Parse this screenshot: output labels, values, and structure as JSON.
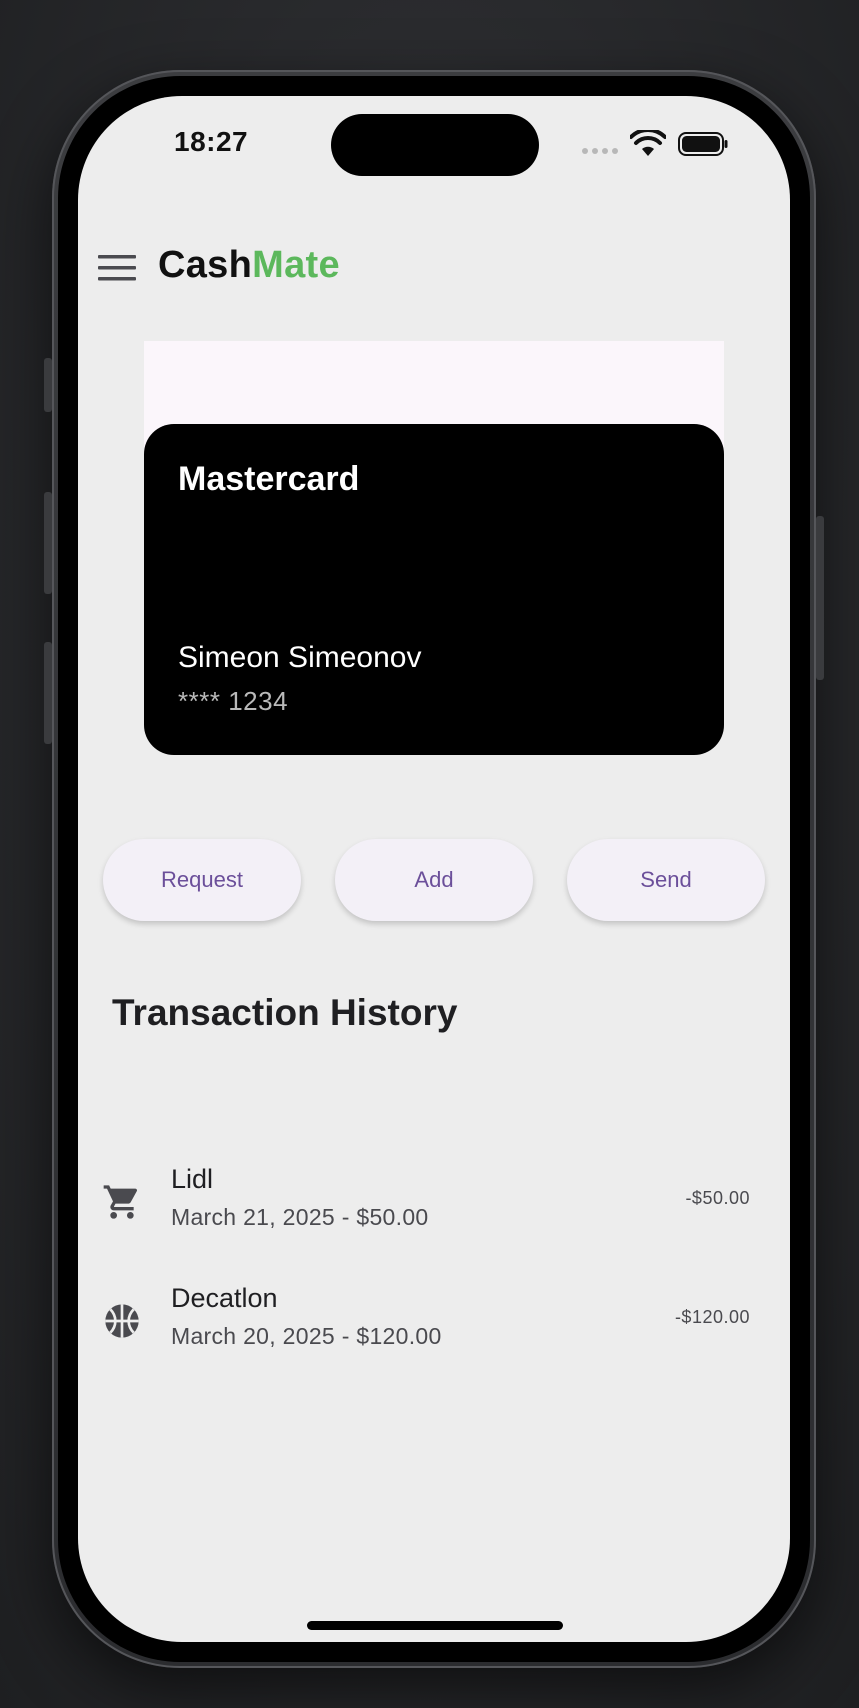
{
  "status_bar": {
    "time": "18:27"
  },
  "app_bar": {
    "brand_part1": "Cash",
    "brand_part2": "Mate"
  },
  "card": {
    "brand": "Mastercard",
    "holder": "Simeon Simeonov",
    "number": "**** 1234"
  },
  "actions": [
    {
      "label": "Request"
    },
    {
      "label": "Add"
    },
    {
      "label": "Send"
    }
  ],
  "transactions": {
    "title": "Transaction History",
    "items": [
      {
        "icon": "shopping-cart-icon",
        "title": "Lidl",
        "subtitle": "March 21, 2025 - $50.00",
        "amount": "-$50.00"
      },
      {
        "icon": "basketball-icon",
        "title": "Decatlon",
        "subtitle": "March 20, 2025 - $120.00",
        "amount": "-$120.00"
      }
    ]
  },
  "colors": {
    "brand_accent": "#5cb85c",
    "button_text": "#6b4f9a",
    "button_bg": "#f3f0f7",
    "card_bg": "#000000",
    "screen_bg": "#ededed"
  }
}
